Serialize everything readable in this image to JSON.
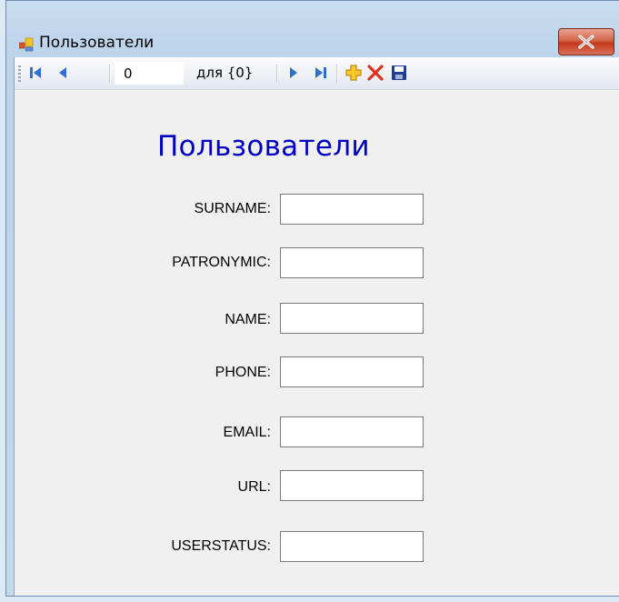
{
  "window": {
    "title": "Пользователи"
  },
  "toolbar": {
    "position_value": "0",
    "count_label": "для {0}",
    "buttons": [
      "move-first-icon",
      "move-previous-icon",
      "move-next-icon",
      "move-last-icon",
      "add-new-icon",
      "delete-icon",
      "save-icon"
    ]
  },
  "form": {
    "title": "Пользователи",
    "fields": [
      {
        "label": "SURNAME:",
        "value": ""
      },
      {
        "label": "PATRONYMIC:",
        "value": ""
      },
      {
        "label": "NAME:",
        "value": ""
      },
      {
        "label": "PHONE:",
        "value": ""
      },
      {
        "label": "EMAIL:",
        "value": ""
      },
      {
        "label": "URL:",
        "value": ""
      },
      {
        "label": "USERSTATUS:",
        "value": ""
      }
    ]
  },
  "colors": {
    "title_blue": "#0000c0",
    "nav_blue": "#2f6fd0",
    "delete_red": "#e0301e",
    "add_yellow": "#f2b705"
  }
}
